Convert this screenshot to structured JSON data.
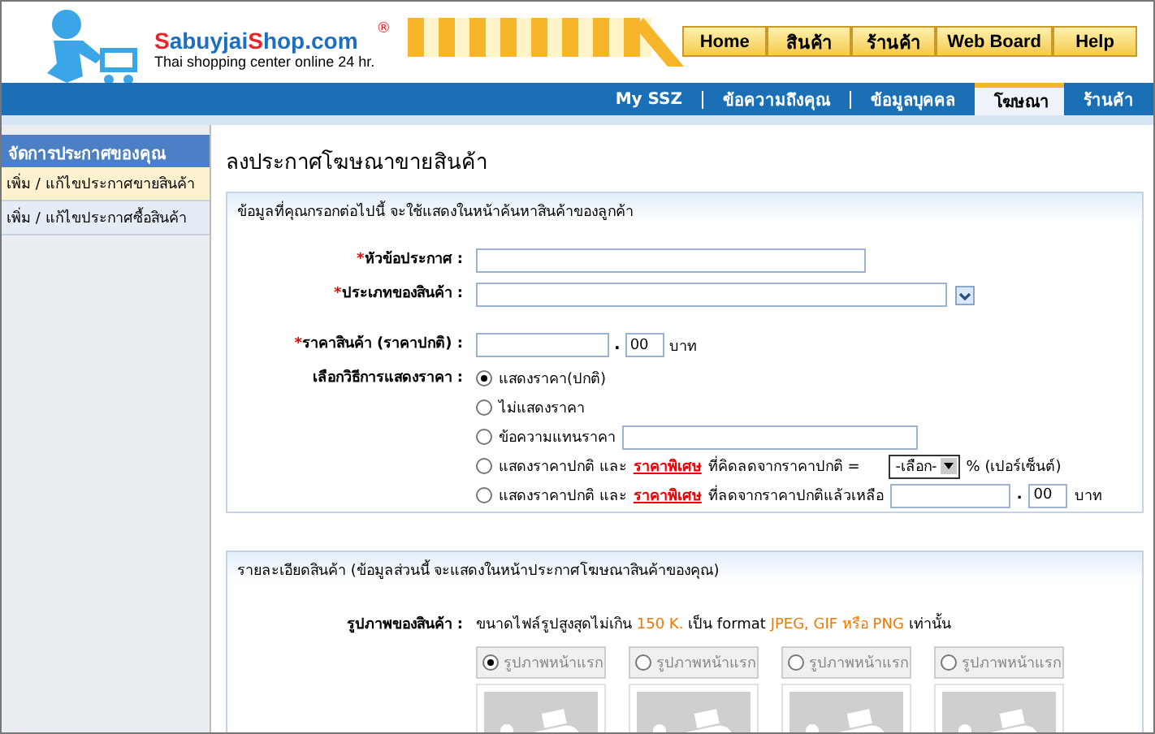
{
  "logo": {
    "parts": [
      {
        "text": "S",
        "kind": "accent"
      },
      {
        "text": "abuyjai",
        "kind": "plain"
      },
      {
        "text": "S",
        "kind": "accent"
      },
      {
        "text": "hop.com",
        "kind": "plain"
      }
    ],
    "mark": "®",
    "tagline": "Thai shopping center online 24 hr."
  },
  "nav": [
    "Home",
    "สินค้า",
    "ร้านค้า",
    "Web Board",
    "Help"
  ],
  "tabs": [
    {
      "label": "My SSZ",
      "selected": false
    },
    {
      "label": "ข้อความถึงคุณ",
      "selected": false
    },
    {
      "label": "ข้อมูลบุคคล",
      "selected": false
    },
    {
      "label": "โฆษณา",
      "selected": true
    },
    {
      "label": "ร้านค้า",
      "selected": false
    }
  ],
  "sidebar": {
    "title": "จัดการประกาศของคุณ",
    "items": [
      {
        "label": "เพิ่ม / แก้ไขประกาศขายสินค้า",
        "selected": true
      },
      {
        "label": "เพิ่ม / แก้ไขประกาศซื้อสินค้า",
        "selected": false
      }
    ]
  },
  "page_title": "ลงประกาศโฆษณาขายสินค้า",
  "section1": {
    "header": "ข้อมูลที่คุณกรอกต่อไปนี้ จะใช้แสดงในหน้าค้นหาสินค้าของลูกค้า",
    "required_mark": "*",
    "decimal_point": ".",
    "title_required": true,
    "category_required": true,
    "price_required": true,
    "title_label": "หัวข้อประกาศ :",
    "category_label": "ประเภทของสินค้า :",
    "price_label": "ราคาสินค้า (ราคาปกติ) :",
    "price_decimals": "00",
    "price_unit": "บาท",
    "display_label": "เลือกวิธีการแสดงราคา :",
    "options": [
      {
        "kind": "plain",
        "selected": true,
        "text": "แสดงราคา(ปกติ)"
      },
      {
        "kind": "plain",
        "selected": false,
        "text": "ไม่แสดงราคา"
      },
      {
        "kind": "text_input",
        "selected": false,
        "text": "ข้อความแทนราคา"
      },
      {
        "kind": "percent",
        "selected": false,
        "text": "แสดงราคาปกติ และ",
        "link": "ราคาพิเศษ",
        "after": "ที่คิดลดจากราคาปกติ =",
        "select": "-เลือก-",
        "suffix": "% (เปอร์เซ็นต์)"
      },
      {
        "kind": "amount",
        "selected": false,
        "text": "แสดงราคาปกติ และ",
        "link": "ราคาพิเศษ",
        "after": "ที่ลดจากราคาปกติแล้วเหลือ",
        "decimals": "00",
        "suffix": "บาท"
      }
    ]
  },
  "section2": {
    "header": "รายละเอียดสินค้า (ข้อมูลส่วนนี้ จะแสดงในหน้าประกาศโฆษณาสินค้าของคุณ)",
    "image_label": "รูปภาพของสินค้า :",
    "info": [
      {
        "text": "ขนาดไฟล์รูปสูงสุดไม่เกิน ",
        "highlight": false
      },
      {
        "text": "150 K.",
        "highlight": true
      },
      {
        "text": " เป็น format ",
        "highlight": false
      },
      {
        "text": "JPEG, GIF หรือ PNG",
        "highlight": true
      },
      {
        "text": " เท่านั้น",
        "highlight": false
      }
    ],
    "slots": [
      {
        "label": "รูปภาพหน้าแรก",
        "selected": true
      },
      {
        "label": "รูปภาพหน้าแรก",
        "selected": false
      },
      {
        "label": "รูปภาพหน้าแรก",
        "selected": false
      },
      {
        "label": "รูปภาพหน้าแรก",
        "selected": false
      }
    ]
  }
}
